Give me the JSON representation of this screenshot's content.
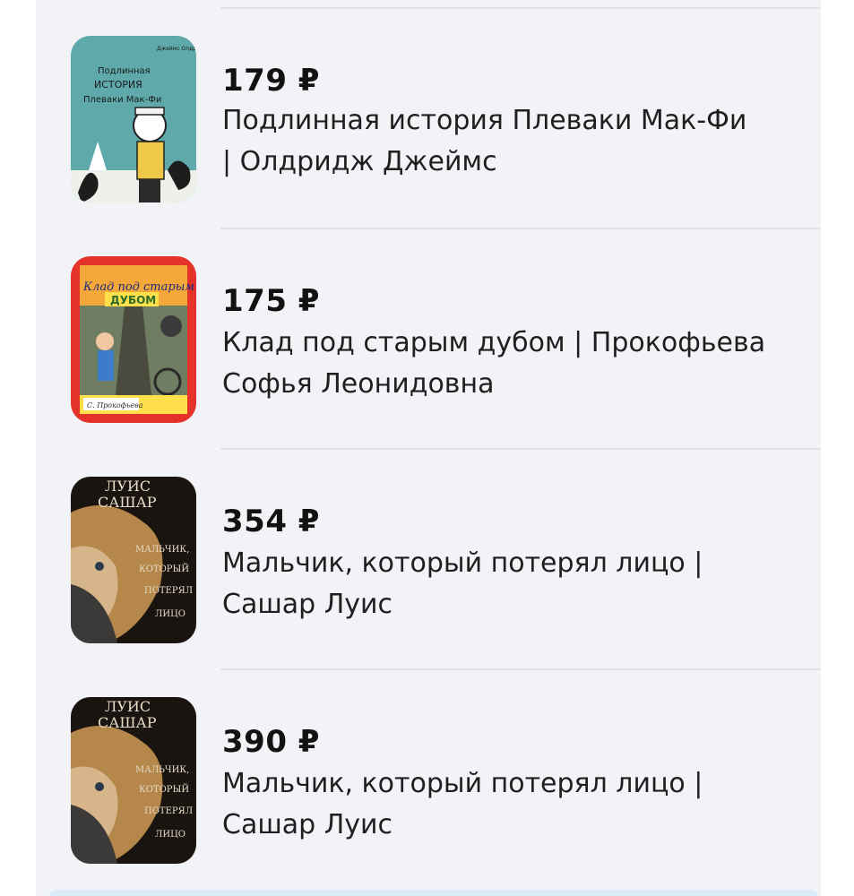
{
  "products": [
    {
      "price": "179 ₽",
      "title_line1": "Подлинная история Плеваки Мак-Фи",
      "title_line2": "| Олдридж Джеймс",
      "cover_icon": "book-cover-image",
      "cover_colors": [
        "#5aa6a8",
        "#f0c948",
        "#2b2b2b"
      ]
    },
    {
      "price": "175 ₽",
      "title_line1": "Клад под старым дубом | Прокофьева",
      "title_line2": "Софья Леонидовна",
      "cover_icon": "book-cover-image",
      "cover_colors": [
        "#e5322b",
        "#ffe04a",
        "#3d7cc9"
      ]
    },
    {
      "price": "354 ₽",
      "title_line1": "Мальчик, который потерял лицо |",
      "title_line2": "Сашар Луис",
      "cover_icon": "book-cover-image",
      "cover_colors": [
        "#1a1410",
        "#b5874a",
        "#e8dcc8"
      ]
    },
    {
      "price": "390 ₽",
      "title_line1": "Мальчик, который потерял лицо |",
      "title_line2": "Сашар Луис",
      "cover_icon": "book-cover-image",
      "cover_colors": [
        "#1a1410",
        "#b5874a",
        "#e8dcc8"
      ]
    }
  ],
  "theme": {
    "background": "#f2f3f7",
    "divider": "#e1e3ea",
    "text": "#1f1f1f"
  }
}
